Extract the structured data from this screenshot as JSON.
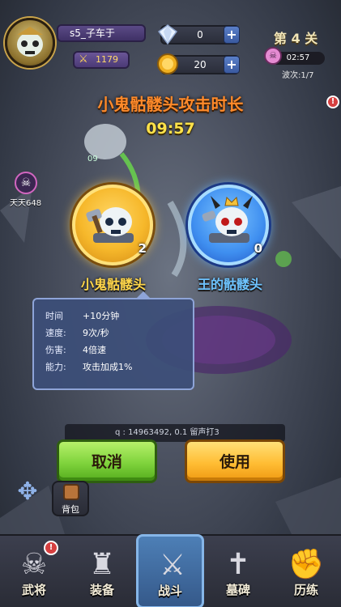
{
  "player": {
    "name": "s5_子车于",
    "power": "1179"
  },
  "resources": {
    "diamonds": "0",
    "coins": "20"
  },
  "stage": {
    "label": "第 4 关",
    "timer": "02:57",
    "wave": "波次:1/7"
  },
  "side": {
    "player_tag": "天天648",
    "enemy_hint": "09"
  },
  "popup": {
    "title": "小鬼骷髅头攻击时长",
    "countdown": "09:57",
    "items": [
      {
        "label": "小鬼骷髅头",
        "count": "2",
        "color": "#ffd64a"
      },
      {
        "label": "王的骷髅头",
        "count": "0",
        "color": "#6ec4ff"
      }
    ],
    "info": [
      {
        "key": "时间",
        "value": "+10分钟"
      },
      {
        "key": "速度:",
        "value": "9次/秒"
      },
      {
        "key": "伤害:",
        "value": "4倍速"
      },
      {
        "key": "能力:",
        "value": "攻击加成1%"
      }
    ],
    "cancel_label": "取消",
    "use_label": "使用"
  },
  "chat": {
    "text": "q : 14963492, 0.1 留声打3"
  },
  "bag_label": "背包",
  "nav": [
    {
      "label": "武将",
      "icon": "skull-icon"
    },
    {
      "label": "装备",
      "icon": "armor-icon"
    },
    {
      "label": "战斗",
      "icon": "crossed-swords-icon"
    },
    {
      "label": "墓碑",
      "icon": "tombstone-icon"
    },
    {
      "label": "历练",
      "icon": "fist-icon"
    }
  ],
  "colors": {
    "title": "#ff8a2a",
    "countdown": "#ffe24a",
    "cancel": "#7fd33c",
    "use": "#ffbd34"
  }
}
